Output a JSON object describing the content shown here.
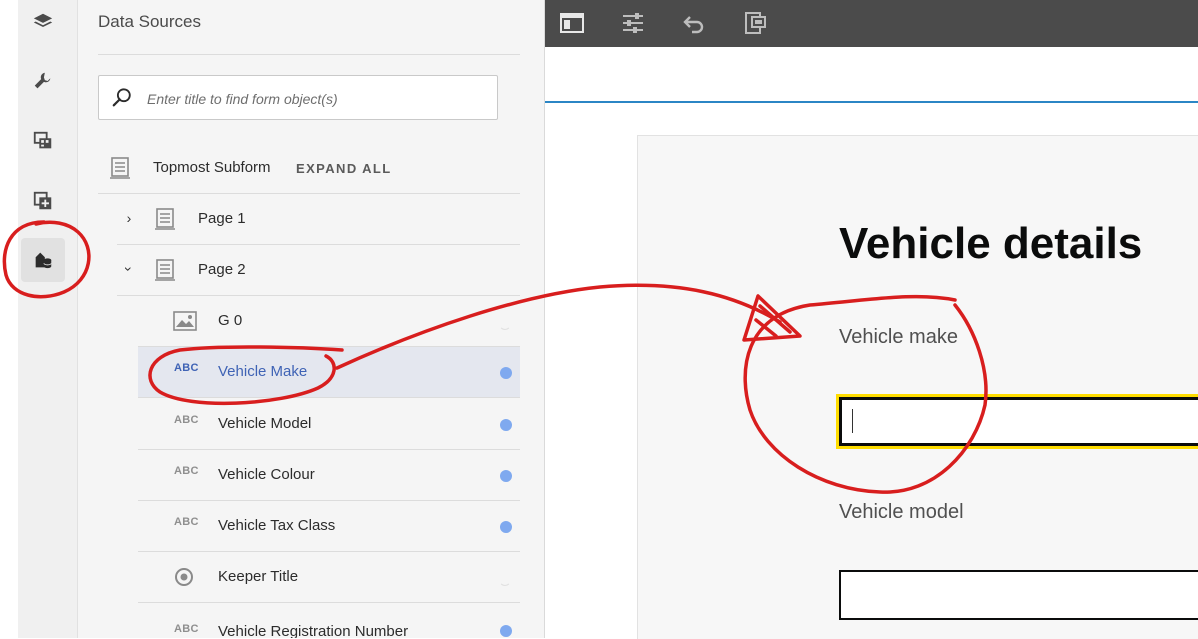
{
  "rail": {
    "items": [
      {
        "icon": "layers-icon"
      },
      {
        "icon": "wrench-icon"
      },
      {
        "icon": "assets-icon"
      },
      {
        "icon": "add-fragment-icon"
      },
      {
        "icon": "data-sources-icon",
        "active": true
      }
    ]
  },
  "panel": {
    "title": "Data Sources",
    "search_placeholder": "Enter title to find form object(s)",
    "expand_all": "EXPAND ALL",
    "tree": {
      "root": {
        "label": "Topmost Subform"
      },
      "page1": {
        "label": "Page 1",
        "expanded": false
      },
      "page2": {
        "label": "Page 2",
        "expanded": true
      },
      "items": [
        {
          "type_label": "",
          "label": "G 0",
          "icon": "image-icon",
          "bound": false
        },
        {
          "type_label": "ABC",
          "label": "Vehicle Make",
          "icon": "text-field-icon",
          "bound": true,
          "selected": true
        },
        {
          "type_label": "ABC",
          "label": "Vehicle Model",
          "icon": "text-field-icon",
          "bound": true
        },
        {
          "type_label": "ABC",
          "label": "Vehicle Colour",
          "icon": "text-field-icon",
          "bound": true
        },
        {
          "type_label": "ABC",
          "label": "Vehicle Tax Class",
          "icon": "text-field-icon",
          "bound": true
        },
        {
          "type_label": "",
          "label": "Keeper Title",
          "icon": "radio-group-icon",
          "bound": false
        },
        {
          "type_label": "ABC",
          "label": "Vehicle Registration Number",
          "icon": "text-field-icon",
          "bound": true
        }
      ]
    }
  },
  "toolbar": {
    "items": [
      "sidebar-toggle-icon",
      "properties-icon",
      "undo-icon",
      "preview-icon"
    ]
  },
  "form": {
    "title": "Vehicle details",
    "fields": [
      {
        "label": "Vehicle make",
        "value": "",
        "focused": true
      },
      {
        "label": "Vehicle model",
        "value": "",
        "focused": false
      }
    ]
  },
  "colors": {
    "accent": "#2b86c5",
    "selection_bg": "#e4e7ef",
    "selection_text": "#3f63b5",
    "bound_dot": "#7fa9ef",
    "focus_ring": "#ffdd00",
    "annotation_red": "#d81e1e"
  }
}
